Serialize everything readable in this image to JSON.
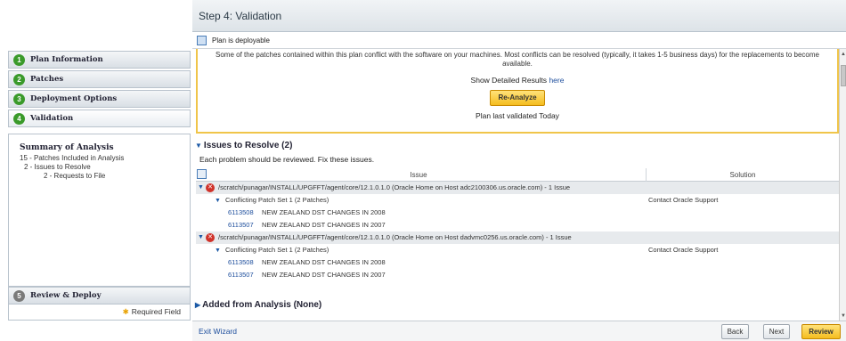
{
  "header": {
    "title": "Step 4: Validation"
  },
  "status": {
    "text": "Plan is deployable"
  },
  "steps": [
    {
      "number": "1",
      "label": "Plan Information"
    },
    {
      "number": "2",
      "label": "Patches"
    },
    {
      "number": "3",
      "label": "Deployment Options"
    },
    {
      "number": "4",
      "label": "Validation"
    },
    {
      "number": "5",
      "label": "Review & Deploy"
    }
  ],
  "summary": {
    "title": "Summary of Analysis",
    "rows": [
      "15 - Patches Included in Analysis",
      "2 - Issues to Resolve",
      "2 - Requests to File"
    ]
  },
  "required_field": "Required Field",
  "deploy_box": {
    "message": "Some of the patches contained within this plan conflict with the software on your machines.  Most conflicts can be resolved (typically, it takes 1-5 business days) for the replacements to become available.",
    "detail_prefix": "Show Detailed Results",
    "detail_link": "here",
    "reanalyze_label": "Re-Analyze",
    "validated": "Plan last validated Today"
  },
  "issues": {
    "heading": "Issues to Resolve (2)",
    "description": "Each problem should be reviewed. Fix these issues.",
    "col_issue": "Issue",
    "col_solution": "Solution",
    "groups": [
      {
        "path": "/scratch/punagar/INSTALL/UPGFFT/agent/core/12.1.0.1.0 (Oracle Home on Host adc2100306.us.oracle.com) - 1 Issue",
        "conflict": "Conflicting Patch Set 1 (2 Patches)",
        "solution": "Contact Oracle Support",
        "patches": [
          {
            "id": "6113508",
            "desc": "NEW ZEALAND DST CHANGES IN 2008"
          },
          {
            "id": "6113507",
            "desc": "NEW ZEALAND DST CHANGES IN 2007"
          }
        ]
      },
      {
        "path": "/scratch/punagar/INSTALL/UPGFFT/agent/core/12.1.0.1.0 (Oracle Home on Host dadvmc0256.us.oracle.com) - 1 Issue",
        "conflict": "Conflicting Patch Set 1 (2 Patches)",
        "solution": "Contact Oracle Support",
        "patches": [
          {
            "id": "6113508",
            "desc": "NEW ZEALAND DST CHANGES IN 2008"
          },
          {
            "id": "6113507",
            "desc": "NEW ZEALAND DST CHANGES IN 2007"
          }
        ]
      }
    ]
  },
  "added": {
    "heading": "Added from Analysis (None)"
  },
  "footer": {
    "exit": "Exit Wizard",
    "back": "Back",
    "next": "Next",
    "review": "Review"
  },
  "colors": {
    "accent": "#f5bd1f",
    "done": "#3a9a2a",
    "link": "#1c4d9c",
    "error": "#d0322a"
  },
  "icons": [
    "check-step-icon",
    "plan-status-icon",
    "error-icon",
    "expand-triangle-icon",
    "collapse-triangle-icon",
    "table-options-icon"
  ]
}
